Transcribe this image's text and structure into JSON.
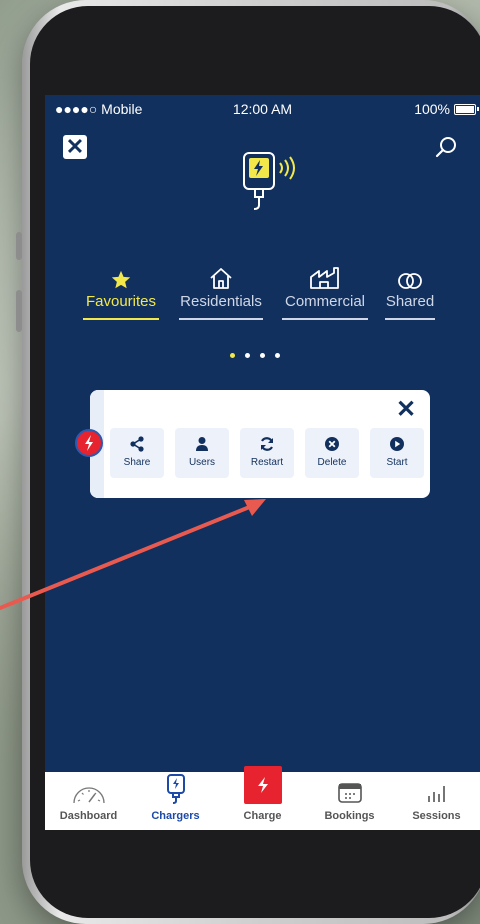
{
  "status": {
    "carrier": "●●●●○ Mobile",
    "time": "12:00 AM",
    "battery": "100%"
  },
  "tabs": [
    {
      "label": "Favourites",
      "icon": "star-icon",
      "active": true
    },
    {
      "label": "Residentials",
      "icon": "house-icon",
      "active": false
    },
    {
      "label": "Commercial",
      "icon": "factory-icon",
      "active": false
    },
    {
      "label": "Shared",
      "icon": "shared-rings-icon",
      "active": false
    }
  ],
  "pager": {
    "count": 4,
    "active": 0
  },
  "card": {
    "actions": [
      {
        "label": "Share",
        "icon": "share-icon"
      },
      {
        "label": "Users",
        "icon": "user-icon"
      },
      {
        "label": "Restart",
        "icon": "refresh-icon"
      },
      {
        "label": "Delete",
        "icon": "delete-icon"
      },
      {
        "label": "Start",
        "icon": "play-icon"
      }
    ]
  },
  "tabbar": [
    {
      "label": "Dashboard",
      "icon": "gauge-icon"
    },
    {
      "label": "Chargers",
      "icon": "charger-icon",
      "active": true
    },
    {
      "label": "Charge",
      "icon": "bolt-icon"
    },
    {
      "label": "Bookings",
      "icon": "calendar-icon"
    },
    {
      "label": "Sessions",
      "icon": "bar-chart-icon"
    }
  ],
  "colors": {
    "background": "#12305e",
    "accent": "#f2e84a",
    "charge": "#e6232e",
    "arrow": "#e85a4f"
  }
}
